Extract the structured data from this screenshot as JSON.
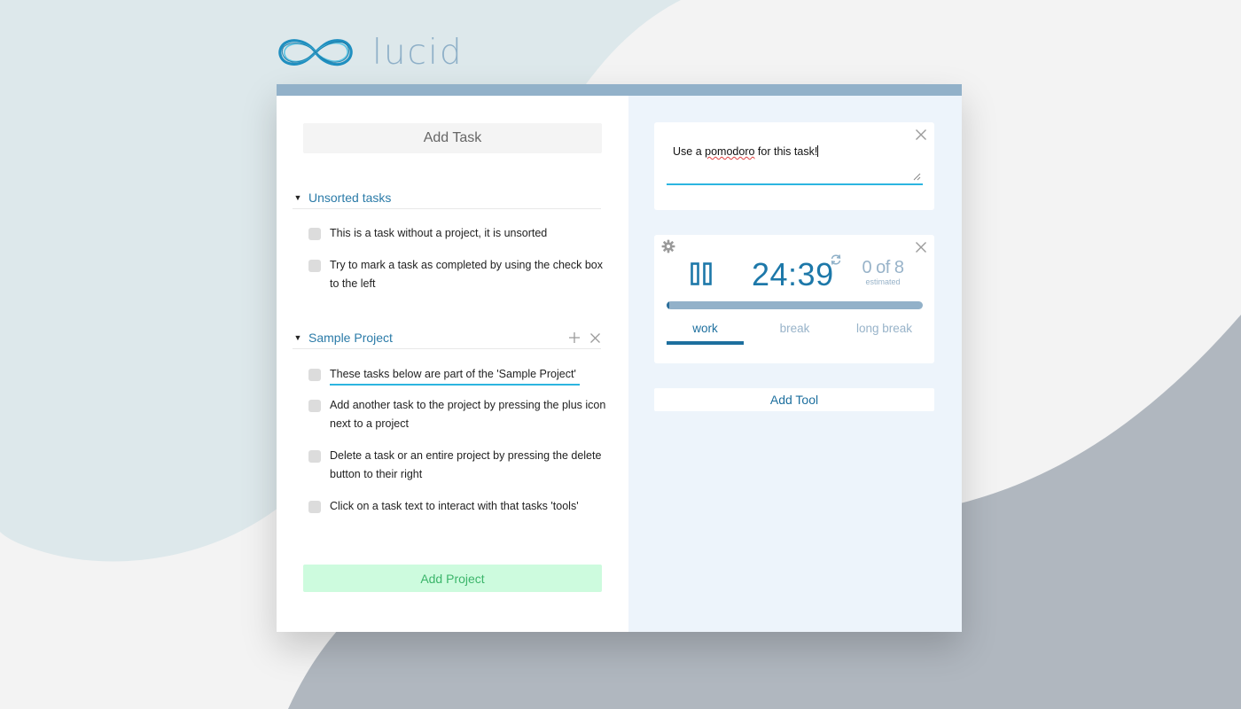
{
  "brand": {
    "name": "lucid"
  },
  "colors": {
    "accent_blue": "#1d78a9",
    "topbar": "#92b1c9",
    "highlight_cyan": "#2cb5e0",
    "add_project_bg": "#cdfbde",
    "add_project_text": "#3bb56a",
    "right_panel_bg": "#edf4fb"
  },
  "left_panel": {
    "add_task_label": "Add Task",
    "add_project_label": "Add Project",
    "sections": [
      {
        "title": "Unsorted tasks",
        "expanded": true,
        "tasks": [
          {
            "text": "This is a task without a project, it is unsorted",
            "completed": false
          },
          {
            "text": "Try to mark a task as completed by using the check box to the left",
            "completed": false
          }
        ]
      },
      {
        "title": "Sample Project",
        "expanded": true,
        "icons": [
          "plus-icon",
          "close-icon"
        ],
        "tasks": [
          {
            "text": "These tasks below are part of the 'Sample Project'",
            "completed": false,
            "selected": true
          },
          {
            "text": "Add another task to the project by pressing the plus icon next to a project",
            "completed": false
          },
          {
            "text": "Delete a task or an entire project by pressing the delete button to their right",
            "completed": false
          },
          {
            "text": "Click on a task text to interact with that tasks 'tools'",
            "completed": false
          }
        ]
      }
    ]
  },
  "right_panel": {
    "notes": {
      "text_before": "Use a ",
      "text_misspelled": "pomodoro",
      "text_after": " for this task!"
    },
    "pomodoro": {
      "timer": "24:39",
      "count": "0 of 8",
      "count_caption": "estimated",
      "progress": 0.01,
      "modes": [
        "work",
        "break",
        "long break"
      ],
      "active_mode": "work"
    },
    "add_tool_label": "Add Tool"
  }
}
